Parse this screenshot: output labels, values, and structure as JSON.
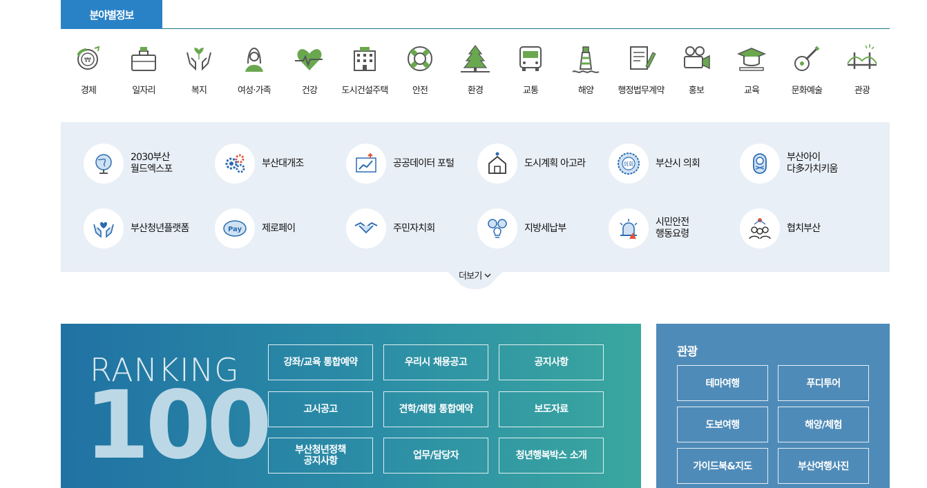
{
  "tab": {
    "label": "분야별정보"
  },
  "categories": [
    {
      "label": "경제",
      "icon": "economy-icon"
    },
    {
      "label": "일자리",
      "icon": "briefcase-icon"
    },
    {
      "label": "복지",
      "icon": "welfare-hands-icon"
    },
    {
      "label": "여성·가족",
      "icon": "woman-icon"
    },
    {
      "label": "건강",
      "icon": "heart-pulse-icon"
    },
    {
      "label": "도시건설주택",
      "icon": "building-icon"
    },
    {
      "label": "안전",
      "icon": "lifebuoy-icon"
    },
    {
      "label": "환경",
      "icon": "trees-icon"
    },
    {
      "label": "교통",
      "icon": "bus-icon"
    },
    {
      "label": "해양",
      "icon": "lighthouse-icon"
    },
    {
      "label": "행정법무계약",
      "icon": "document-pen-icon"
    },
    {
      "label": "홍보",
      "icon": "camera-icon"
    },
    {
      "label": "교육",
      "icon": "graduation-cap-icon"
    },
    {
      "label": "문화예술",
      "icon": "guitar-icon"
    },
    {
      "label": "관광",
      "icon": "bridge-icon"
    }
  ],
  "quick_links": [
    {
      "label": "2030부산\n월드엑스포",
      "icon": "globe-icon"
    },
    {
      "label": "부산대개조",
      "icon": "gears-icon"
    },
    {
      "label": "공공데이터 포털",
      "icon": "data-chart-icon"
    },
    {
      "label": "도시계획 아고라",
      "icon": "house-plan-icon"
    },
    {
      "label": "부산시 의회",
      "icon": "council-emblem-icon"
    },
    {
      "label": "부산아이\n다多가치키움",
      "icon": "baby-icon"
    },
    {
      "label": "부산청년플랫폼",
      "icon": "youth-hands-icon"
    },
    {
      "label": "제로페이",
      "icon": "pay-icon"
    },
    {
      "label": "주민자치회",
      "icon": "handshake-icon"
    },
    {
      "label": "지방세납부",
      "icon": "tax-bulb-icon"
    },
    {
      "label": "시민안전\n행동요령",
      "icon": "alarm-icon"
    },
    {
      "label": "협치부산",
      "icon": "people-icon"
    }
  ],
  "more": {
    "label": "더보기"
  },
  "ranking": {
    "word": "RANKING",
    "number": "100",
    "buttons": [
      "강좌/교육 통합예약",
      "우리시 채용공고",
      "공지사항",
      "고시공고",
      "견학/체험 통합예약",
      "보도자료",
      "부산청년정책\n공지사항",
      "업무/담당자",
      "청년행복박스 소개"
    ]
  },
  "tourism": {
    "title": "관광",
    "buttons": [
      "테마여행",
      "푸디투어",
      "도보여행",
      "해양/체험",
      "가이드북&지도",
      "부산여행사진"
    ]
  },
  "colors": {
    "accent": "#2a82c6",
    "icon_green": "#6aa84f",
    "panel_bg": "#e9eff6"
  }
}
